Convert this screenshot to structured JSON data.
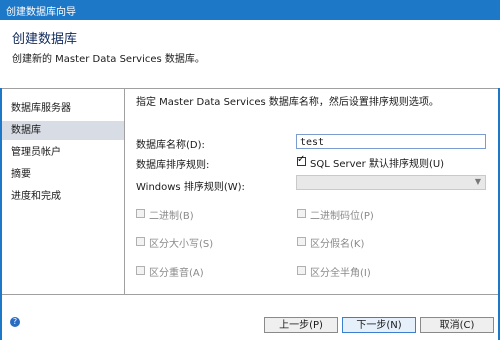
{
  "window": {
    "title": "创建数据库向导"
  },
  "header": {
    "title": "创建数据库",
    "subtitle": "创建新的 Master Data Services 数据库。"
  },
  "sidebar": {
    "items": [
      {
        "label": "数据库服务器"
      },
      {
        "label": "数据库"
      },
      {
        "label": "管理员帐户"
      },
      {
        "label": "摘要"
      },
      {
        "label": "进度和完成"
      }
    ]
  },
  "main": {
    "intro": "指定 Master Data Services 数据库名称，然后设置排序规则选项。",
    "db_name": {
      "label": "数据库名称(D):",
      "value": "test"
    },
    "collation": {
      "label": "数据库排序规则:",
      "sql_default_label": "SQL Server 默认排序规则(U)",
      "sql_default_checked": true
    },
    "windows_collation": {
      "label": "Windows 排序规则(W):",
      "value": ""
    },
    "options": {
      "binary": "二进制(B)",
      "binary_code_point": "二进制码位(P)",
      "case_sensitive": "区分大小写(S)",
      "kana_sensitive": "区分假名(K)",
      "accent_sensitive": "区分重音(A)",
      "width_sensitive": "区分全半角(I)"
    }
  },
  "footer": {
    "help_icon": "?",
    "back_label": "上一步(P)",
    "next_label": "下一步(N)",
    "cancel_label": "取消(C)"
  },
  "colors": {
    "accent": "#1e78c8",
    "sidebar_active": "#d8dde5"
  }
}
